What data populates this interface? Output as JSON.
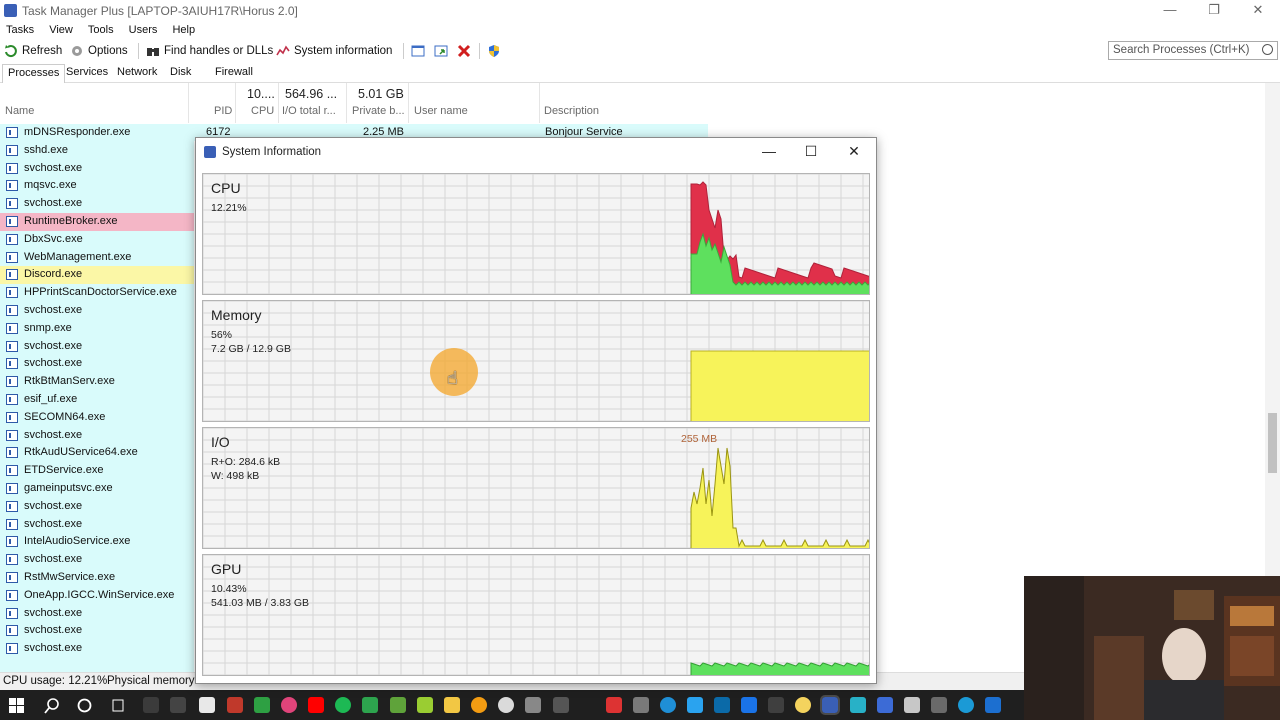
{
  "window": {
    "title": "Task Manager Plus [LAPTOP-3AIUH17R\\Horus 2.0]",
    "minimize_glyph": "—",
    "restore_glyph": "❐",
    "close_glyph": "✕"
  },
  "menu": [
    "Tasks",
    "View",
    "Tools",
    "Users",
    "Help"
  ],
  "toolbar": {
    "refresh": "Refresh",
    "options": "Options",
    "find_handles": "Find handles or DLLs",
    "system_information": "System information"
  },
  "search": {
    "placeholder": "Search Processes (Ctrl+K)"
  },
  "tabs": [
    "Processes",
    "Services",
    "Network",
    "Disk",
    "Firewall"
  ],
  "grid": {
    "summary": {
      "cpu": "10....",
      "io": "564.96 ...",
      "private": "5.01 GB"
    },
    "columns": {
      "name": "Name",
      "pid": "PID",
      "cpu": "CPU",
      "io": "I/O total r...",
      "private": "Private b...",
      "user": "User name",
      "description": "Description"
    },
    "first_row": {
      "pid": "6172",
      "private": "2.25 MB",
      "description": "Bonjour Service"
    }
  },
  "processes": [
    {
      "name": "mDNSResponder.exe",
      "hl": ""
    },
    {
      "name": "sshd.exe",
      "hl": ""
    },
    {
      "name": "svchost.exe",
      "hl": ""
    },
    {
      "name": "mqsvc.exe",
      "hl": ""
    },
    {
      "name": "svchost.exe",
      "hl": ""
    },
    {
      "name": "RuntimeBroker.exe",
      "hl": "pink"
    },
    {
      "name": "DbxSvc.exe",
      "hl": ""
    },
    {
      "name": "WebManagement.exe",
      "hl": ""
    },
    {
      "name": "Discord.exe",
      "hl": "yellow"
    },
    {
      "name": "HPPrintScanDoctorService.exe",
      "hl": ""
    },
    {
      "name": "svchost.exe",
      "hl": ""
    },
    {
      "name": "snmp.exe",
      "hl": ""
    },
    {
      "name": "svchost.exe",
      "hl": ""
    },
    {
      "name": "svchost.exe",
      "hl": ""
    },
    {
      "name": "RtkBtManServ.exe",
      "hl": ""
    },
    {
      "name": "esif_uf.exe",
      "hl": ""
    },
    {
      "name": "SECOMN64.exe",
      "hl": ""
    },
    {
      "name": "svchost.exe",
      "hl": ""
    },
    {
      "name": "RtkAudUService64.exe",
      "hl": ""
    },
    {
      "name": "ETDService.exe",
      "hl": ""
    },
    {
      "name": "gameinputsvc.exe",
      "hl": ""
    },
    {
      "name": "svchost.exe",
      "hl": ""
    },
    {
      "name": "svchost.exe",
      "hl": ""
    },
    {
      "name": "IntelAudioService.exe",
      "hl": ""
    },
    {
      "name": "svchost.exe",
      "hl": ""
    },
    {
      "name": "RstMwService.exe",
      "hl": ""
    },
    {
      "name": "OneApp.IGCC.WinService.exe",
      "hl": ""
    },
    {
      "name": "svchost.exe",
      "hl": ""
    },
    {
      "name": "svchost.exe",
      "hl": ""
    },
    {
      "name": "svchost.exe",
      "hl": ""
    }
  ],
  "status": {
    "cpu": "CPU usage: 12.21%",
    "memory": "Physical memory:"
  },
  "dialog": {
    "title": "System Information",
    "cpu": {
      "title": "CPU",
      "value": "12.21%"
    },
    "memory": {
      "title": "Memory",
      "percent": "56%",
      "usage": "7.2 GB / 12.9 GB"
    },
    "io": {
      "title": "I/O",
      "ro": "R+O: 284.6 kB",
      "w": "W: 498 kB",
      "peak": "255 MB"
    },
    "gpu": {
      "title": "GPU",
      "percent": "10.43%",
      "usage": "541.03 MB / 3.83 GB"
    }
  },
  "colors": {
    "cpu_kernel": "#e0304a",
    "cpu_user": "#5ee05e",
    "memory_fill": "#f7f35a",
    "io_fill": "#f7f35a",
    "gpu_fill": "#5ee05e",
    "grid": "#d6d6d6",
    "process_bg": "#d9fbfb"
  }
}
